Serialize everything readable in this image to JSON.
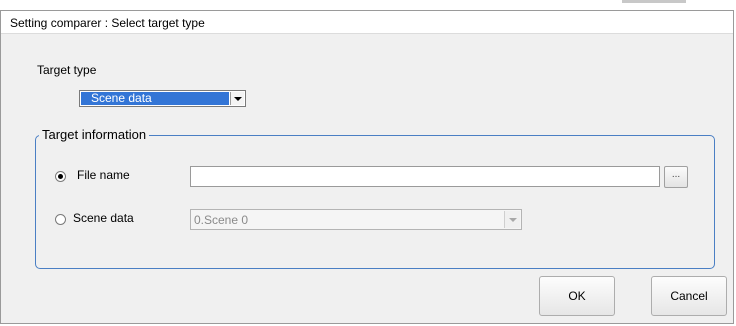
{
  "dialog": {
    "title": "Setting comparer : Select target type"
  },
  "target_type": {
    "label": "Target type",
    "selected": "Scene data"
  },
  "target_information": {
    "legend": "Target information",
    "file_name": {
      "label": "File name",
      "selected": true,
      "value": "",
      "browse_label": "..."
    },
    "scene_data": {
      "label": "Scene data",
      "selected": false,
      "value": "0.Scene 0"
    }
  },
  "buttons": {
    "ok": "OK",
    "cancel": "Cancel"
  },
  "icons": {
    "target_type_dropdown": "chevron-down-icon",
    "scene_dropdown": "chevron-down-icon"
  }
}
